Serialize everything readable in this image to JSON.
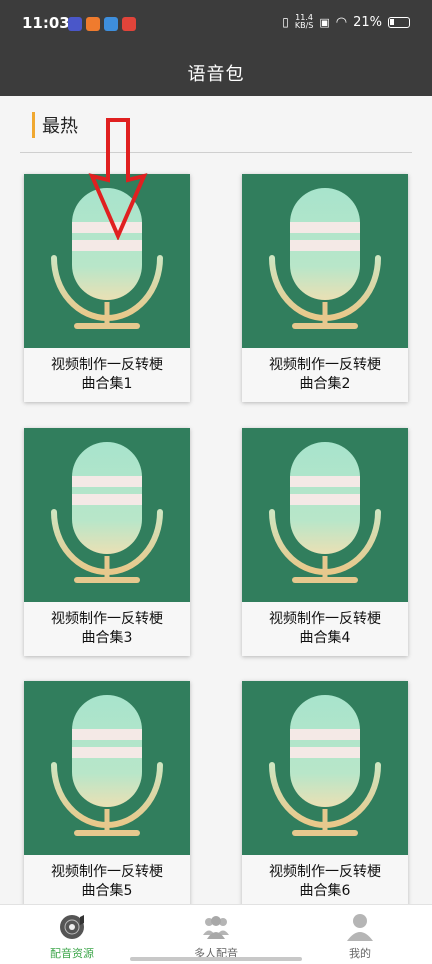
{
  "status_bar": {
    "time": "11:03",
    "net_speed": "11.4",
    "net_unit": "KB/S",
    "battery": "21%"
  },
  "header": {
    "title": "语音包"
  },
  "section": {
    "title": "最热"
  },
  "cards": [
    {
      "line1": "视频制作一反转梗",
      "line2": "曲合集1"
    },
    {
      "line1": "视频制作一反转梗",
      "line2": "曲合集2"
    },
    {
      "line1": "视频制作一反转梗",
      "line2": "曲合集3"
    },
    {
      "line1": "视频制作一反转梗",
      "line2": "曲合集4"
    },
    {
      "line1": "视频制作一反转梗",
      "line2": "曲合集5"
    },
    {
      "line1": "视频制作一反转梗",
      "line2": "曲合集6"
    }
  ],
  "bottom_nav": [
    {
      "label": "配音资源",
      "icon": "record-disc-icon",
      "active": true
    },
    {
      "label": "多人配音",
      "icon": "group-people-icon",
      "active": false
    },
    {
      "label": "我的",
      "icon": "person-icon",
      "active": false
    }
  ],
  "colors": {
    "header_bg": "#3c3c3c",
    "card_thumb_bg": "#317e5d",
    "accent_bar": "#f0a830",
    "nav_active": "#3da64a",
    "annotation_arrow": "#e02020"
  },
  "icons": {
    "card_thumbnail": "microphone-icon",
    "annotation": "down-arrow-icon"
  }
}
